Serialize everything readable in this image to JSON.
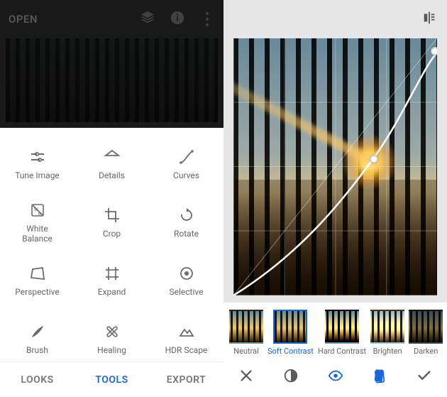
{
  "left": {
    "open_label": "OPEN",
    "tools": [
      {
        "label": "Tune Image",
        "icon": "tune-image-icon"
      },
      {
        "label": "Details",
        "icon": "details-icon"
      },
      {
        "label": "Curves",
        "icon": "curves-icon"
      },
      {
        "label": "White\nBalance",
        "icon": "white-balance-icon"
      },
      {
        "label": "Crop",
        "icon": "crop-icon"
      },
      {
        "label": "Rotate",
        "icon": "rotate-icon"
      },
      {
        "label": "Perspective",
        "icon": "perspective-icon"
      },
      {
        "label": "Expand",
        "icon": "expand-icon"
      },
      {
        "label": "Selective",
        "icon": "selective-icon"
      },
      {
        "label": "Brush",
        "icon": "brush-icon"
      },
      {
        "label": "Healing",
        "icon": "healing-icon"
      },
      {
        "label": "HDR Scape",
        "icon": "hdr-scape-icon"
      }
    ],
    "tabs": [
      {
        "label": "LOOKS",
        "active": false
      },
      {
        "label": "TOOLS",
        "active": true
      },
      {
        "label": "EXPORT",
        "active": false
      }
    ]
  },
  "right": {
    "presets": [
      {
        "label": "Neutral",
        "active": false,
        "variant": "neutral"
      },
      {
        "label": "Soft Contrast",
        "active": true,
        "variant": "soft"
      },
      {
        "label": "Hard Contrast",
        "active": false,
        "variant": "hard"
      },
      {
        "label": "Brighten",
        "active": false,
        "variant": "brighten"
      },
      {
        "label": "Darken",
        "active": false,
        "variant": "darken"
      }
    ],
    "actions": [
      {
        "name": "close-icon"
      },
      {
        "name": "channel-icon"
      },
      {
        "name": "eye-icon",
        "blue": true
      },
      {
        "name": "card-icon",
        "blue": true
      },
      {
        "name": "confirm-icon"
      }
    ]
  }
}
